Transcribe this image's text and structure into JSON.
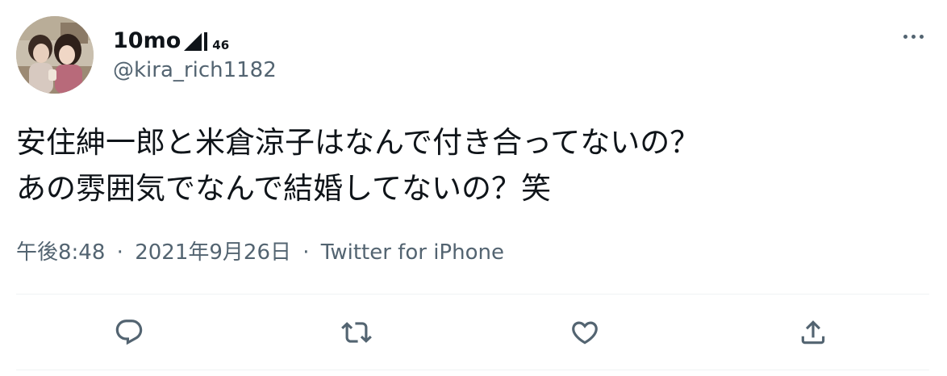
{
  "user": {
    "display_name": "10mo",
    "name_badge_icon": "signal-bars-icon",
    "name_badge_number": "46",
    "handle": "@kira_rich1182",
    "avatar": "avatar-photo"
  },
  "menu": {
    "icon": "more-horizontal-icon"
  },
  "tweet": {
    "lines": [
      "安住紳一郎と米倉涼子はなんで付き合ってないの？",
      "あの雰囲気でなんで結婚してないの？笑"
    ]
  },
  "meta": {
    "time": "午後8:48",
    "date": "2021年9月26日",
    "source": "Twitter for iPhone",
    "separator": "·"
  },
  "actions": [
    {
      "name": "reply",
      "icon": "reply-icon"
    },
    {
      "name": "retweet",
      "icon": "retweet-icon"
    },
    {
      "name": "like",
      "icon": "like-icon"
    },
    {
      "name": "share",
      "icon": "share-icon"
    }
  ],
  "colors": {
    "text": "#0f1419",
    "secondary": "#536471",
    "divider": "#eff3f4"
  }
}
